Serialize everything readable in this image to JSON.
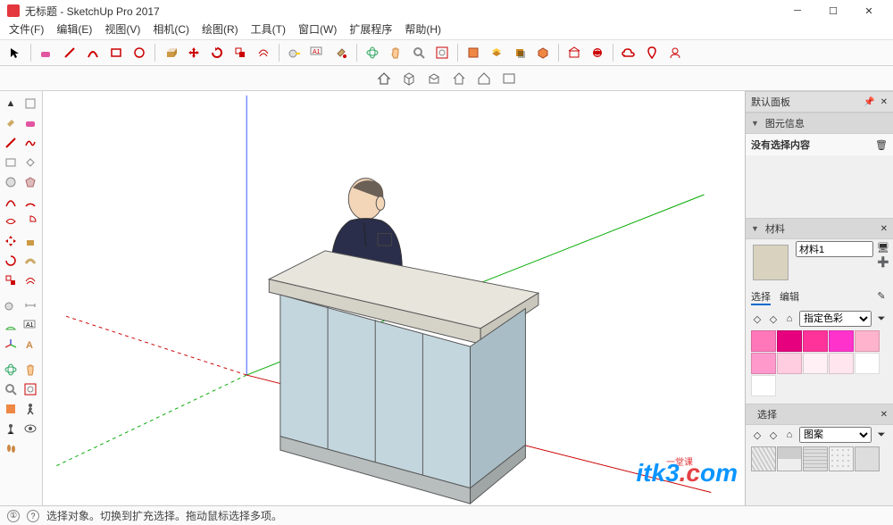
{
  "app": {
    "title": "无标题 - SketchUp Pro 2017"
  },
  "menus": [
    "文件(F)",
    "编辑(E)",
    "视图(V)",
    "相机(C)",
    "绘图(R)",
    "工具(T)",
    "窗口(W)",
    "扩展程序",
    "帮助(H)"
  ],
  "toolbar_main": [
    "select",
    "eraser",
    "line",
    "arc",
    "rect",
    "circle",
    "push-pull",
    "move",
    "rotate3d",
    "scale",
    "offset",
    "tape",
    "text",
    "dimension",
    "paint",
    "orbit",
    "pan",
    "zoom",
    "zoom-extents",
    "prev-view",
    "layers",
    "shadows",
    "xray",
    "iso",
    "3dwarehouse",
    "ext-warehouse",
    "geo",
    "add-location",
    "login"
  ],
  "toolbar_sub": [
    "home",
    "package",
    "open-folder",
    "save",
    "print",
    "undo"
  ],
  "right": {
    "default_panel": "默认面板",
    "entity_info": "图元信息",
    "no_selection": "没有选择内容",
    "materials": "材料",
    "material_name": "材料1",
    "tab_select": "选择",
    "tab_edit": "编辑",
    "preset_label": "指定色彩",
    "patterns_label": "图案",
    "selection_header": "选择",
    "swatches": [
      "#ff77b9",
      "#e6007e",
      "#ff3399",
      "#ff33cc",
      "#ffb3cc",
      "#ff99cc",
      "#ffcce0",
      "#fff0f5",
      "#ffe6ee",
      "#fff",
      "#fff"
    ]
  },
  "status": {
    "hint": "选择对象。切换到扩充选择。拖动鼠标选择多项。"
  },
  "watermark": {
    "text_a": "itk3",
    "text_b": ".c",
    "text_c": "om",
    "sub": "一堂课"
  }
}
